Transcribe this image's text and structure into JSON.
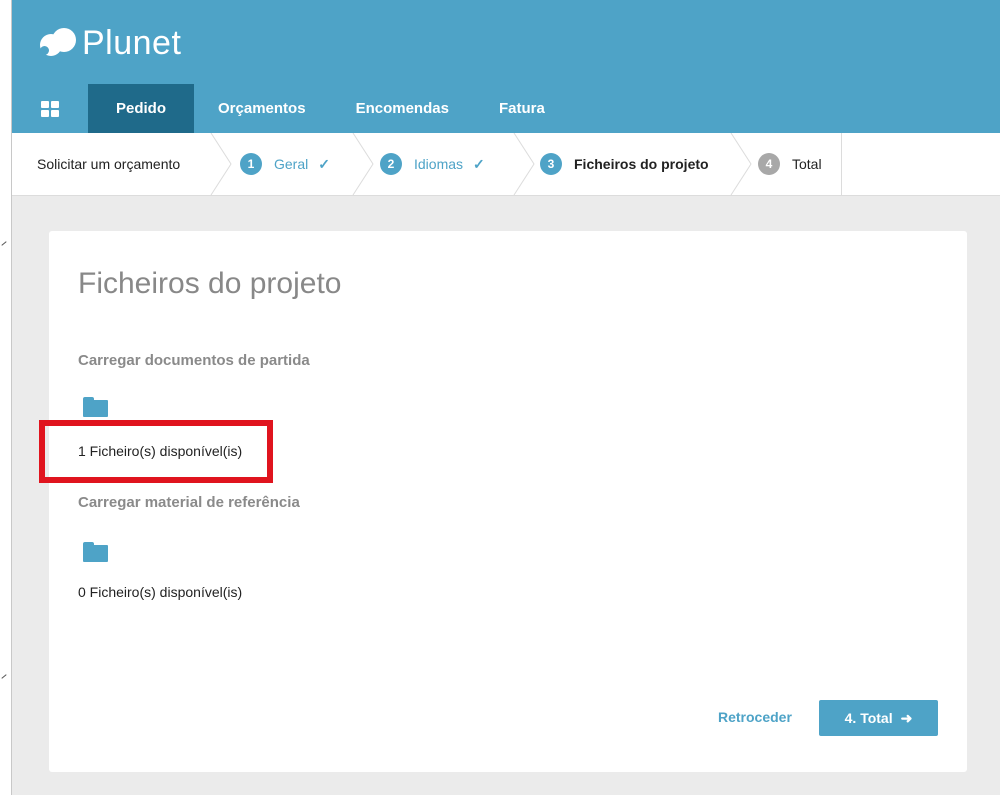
{
  "app": {
    "logo_text": "Plunet"
  },
  "nav": {
    "grid_icon": "apps-grid-icon",
    "items": [
      {
        "label": "Pedido",
        "active": true
      },
      {
        "label": "Orçamentos"
      },
      {
        "label": "Encomendas"
      },
      {
        "label": "Fatura"
      }
    ]
  },
  "steps": {
    "intro": "Solicitar um orçamento",
    "items": [
      {
        "num": "1",
        "label": "Geral",
        "state": "done",
        "check": "✓"
      },
      {
        "num": "2",
        "label": "Idiomas",
        "state": "done",
        "check": "✓"
      },
      {
        "num": "3",
        "label": "Ficheiros do projeto",
        "state": "current"
      },
      {
        "num": "4",
        "label": "Total",
        "state": "pending"
      }
    ]
  },
  "main": {
    "title": "Ficheiros do projeto",
    "sections": [
      {
        "title": "Carregar documentos de partida",
        "icon": "folder-icon",
        "count_text": "1 Ficheiro(s) disponível(is)"
      },
      {
        "title": "Carregar material de referência",
        "icon": "folder-icon",
        "count_text": "0 Ficheiro(s) disponível(is)"
      }
    ],
    "back_label": "Retroceder",
    "next_label": "4. Total",
    "next_arrow": "➜"
  },
  "colors": {
    "brand": "#4ea3c7",
    "nav_active": "#1f6a8a",
    "highlight": "#e0141e"
  }
}
